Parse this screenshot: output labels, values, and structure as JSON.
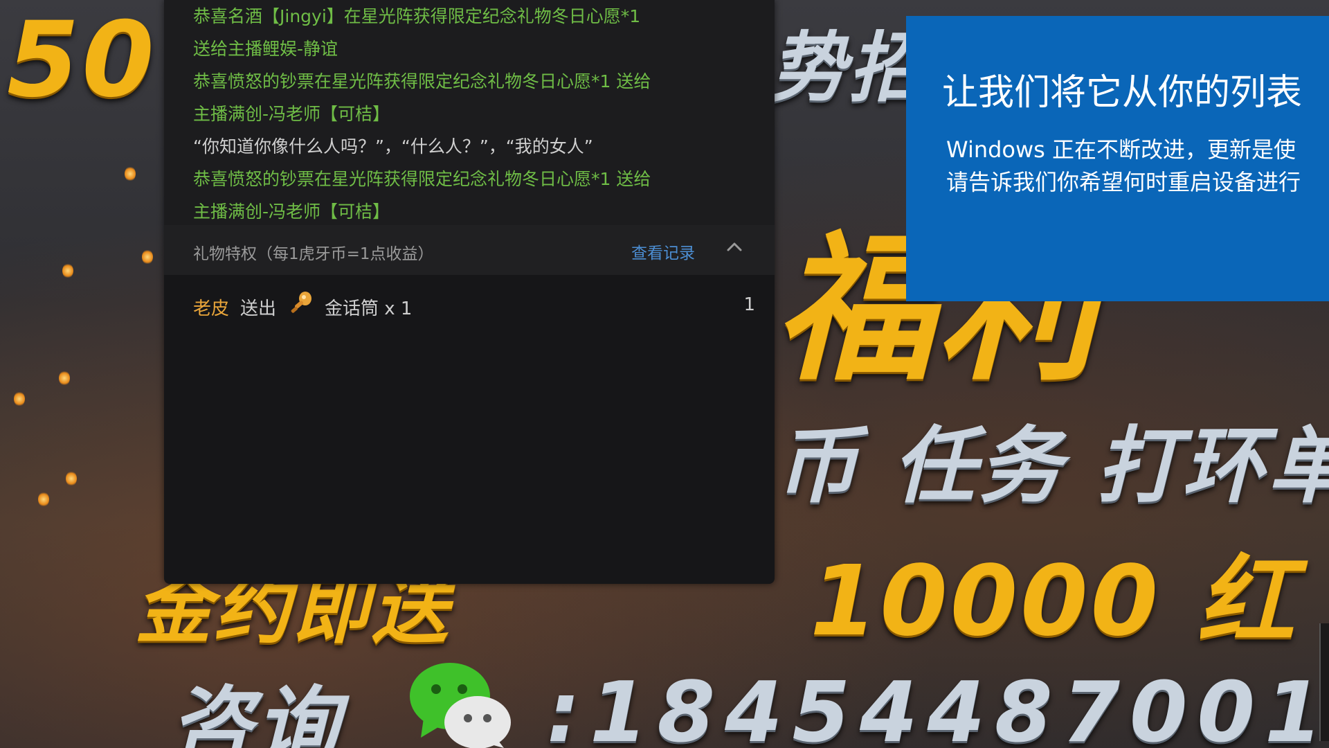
{
  "background": {
    "promo_50": "50",
    "promo_top_right": "势招",
    "promo_fu": "福利",
    "promo_tasks": "币 任务 打环单",
    "promo_amount_left": "金约即送",
    "promo_amount": "10000 红",
    "promo_consult": "咨询",
    "promo_phone": ":18454487001",
    "wechat_icon": "wechat-icon",
    "colors": {
      "gold": "#f2b316",
      "silver": "#c9d3de"
    }
  },
  "chat": {
    "messages": [
      {
        "text": "恭喜名酒【Jingyi】在星光阵获得限定纪念礼物冬日心愿*1"
      },
      {
        "text": "送给主播鲤娱-静谊"
      },
      {
        "text": "恭喜愤怒的钞票在星光阵获得限定纪念礼物冬日心愿*1 送给"
      },
      {
        "text": "主播满创-冯老师【可桔】"
      },
      {
        "text": "“你知道你像什么人吗？”，“什么人？”，“我的女人”"
      },
      {
        "text": "恭喜愤怒的钞票在星光阵获得限定纪念礼物冬日心愿*1 送给"
      },
      {
        "text": "主播满创-冯老师【可桔】"
      }
    ],
    "gift_header": {
      "title": "礼物特权（每1虎牙币=1点收益）",
      "link": "查看记录",
      "toggle_icon": "chevron-up-icon"
    },
    "gifts": [
      {
        "user": "老皮",
        "verb": "送出",
        "icon": "microphone-gift-icon",
        "name": "金话筒 x 1",
        "count": "1"
      }
    ],
    "colors": {
      "system_msg": "#6fbd46",
      "user_name": "#e9a53a",
      "link": "#4c8ed3"
    }
  },
  "windows_toast": {
    "title": "让我们将它从你的列表",
    "body_line1": "Windows 正在不断改进，更新是使",
    "body_line2": "请告诉我们你希望何时重启设备进行",
    "color": "#0a66b8"
  }
}
